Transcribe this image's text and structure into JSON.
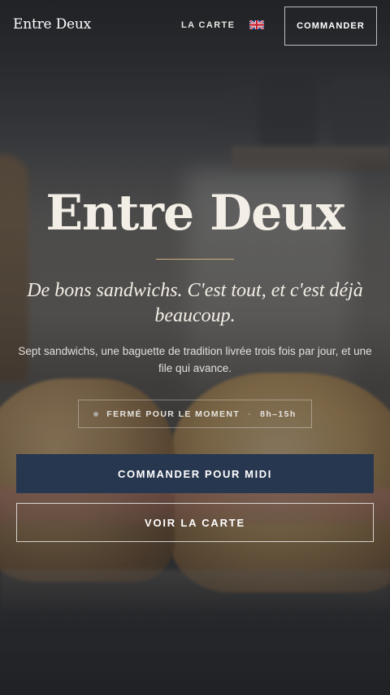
{
  "header": {
    "brand": "Entre Deux",
    "nav_menu_label": "LA CARTE",
    "language_flag": "uk-flag-icon",
    "order_button_label": "COMMANDER"
  },
  "hero": {
    "title": "Entre Deux",
    "tagline": "De bons sandwichs. C'est tout, et c'est déjà beaucoup.",
    "description": "Sept sandwichs, une baguette de tradition livrée trois fois par jour, et une file qui avance.",
    "status": {
      "state": "FERMÉ POUR LE MOMENT",
      "separator": "·",
      "hours": "8h–15h"
    },
    "primary_cta": "COMMANDER POUR MIDI",
    "secondary_cta": "VOIR LA CARTE"
  },
  "colors": {
    "primary_button": "#27374f",
    "accent_divider": "#cdb07a",
    "title_text": "#f4efe6"
  }
}
